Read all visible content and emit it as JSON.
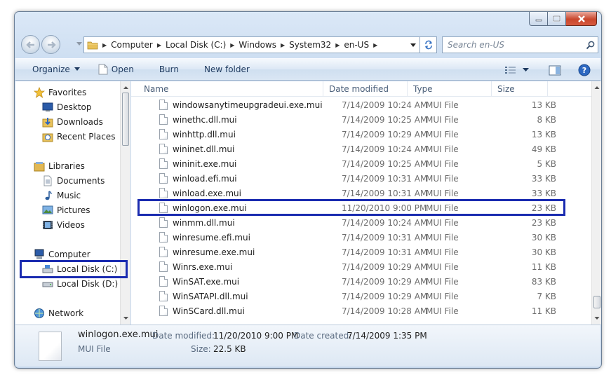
{
  "address": {
    "crumbs": [
      "Computer",
      "Local Disk (C:)",
      "Windows",
      "System32",
      "en-US"
    ]
  },
  "search": {
    "placeholder": "Search en-US"
  },
  "toolbar": {
    "organize": "Organize",
    "open": "Open",
    "burn": "Burn",
    "new_folder": "New folder"
  },
  "nav": {
    "favorites": "Favorites",
    "desktop": "Desktop",
    "downloads": "Downloads",
    "recent_places": "Recent Places",
    "libraries": "Libraries",
    "documents": "Documents",
    "music": "Music",
    "pictures": "Pictures",
    "videos": "Videos",
    "computer": "Computer",
    "local_disk_c": "Local Disk (C:)",
    "local_disk_d": "Local Disk (D:)",
    "network": "Network"
  },
  "columns": {
    "name": "Name",
    "date_modified": "Date modified",
    "type": "Type",
    "size": "Size"
  },
  "files": [
    {
      "name": "windowsanytimeupgradeui.exe.mui",
      "date": "7/14/2009 10:24 AM",
      "type": "MUI File",
      "size": "13 KB"
    },
    {
      "name": "winethc.dll.mui",
      "date": "7/14/2009 10:25 AM",
      "type": "MUI File",
      "size": "8 KB"
    },
    {
      "name": "winhttp.dll.mui",
      "date": "7/14/2009 10:29 AM",
      "type": "MUI File",
      "size": "13 KB"
    },
    {
      "name": "wininet.dll.mui",
      "date": "7/14/2009 10:24 AM",
      "type": "MUI File",
      "size": "49 KB"
    },
    {
      "name": "wininit.exe.mui",
      "date": "7/14/2009 10:25 AM",
      "type": "MUI File",
      "size": "5 KB"
    },
    {
      "name": "winload.efi.mui",
      "date": "7/14/2009 10:31 AM",
      "type": "MUI File",
      "size": "33 KB"
    },
    {
      "name": "winload.exe.mui",
      "date": "7/14/2009 10:31 AM",
      "type": "MUI File",
      "size": "33 KB"
    },
    {
      "name": "winlogon.exe.mui",
      "date": "11/20/2010 9:00 PM",
      "type": "MUI File",
      "size": "23 KB"
    },
    {
      "name": "winmm.dll.mui",
      "date": "7/14/2009 10:24 AM",
      "type": "MUI File",
      "size": "23 KB"
    },
    {
      "name": "winresume.efi.mui",
      "date": "7/14/2009 10:31 AM",
      "type": "MUI File",
      "size": "30 KB"
    },
    {
      "name": "winresume.exe.mui",
      "date": "7/14/2009 10:31 AM",
      "type": "MUI File",
      "size": "30 KB"
    },
    {
      "name": "Winrs.exe.mui",
      "date": "7/14/2009 10:29 AM",
      "type": "MUI File",
      "size": "11 KB"
    },
    {
      "name": "WinSAT.exe.mui",
      "date": "7/14/2009 10:29 AM",
      "type": "MUI File",
      "size": "83 KB"
    },
    {
      "name": "WinSATAPI.dll.mui",
      "date": "7/14/2009 10:29 AM",
      "type": "MUI File",
      "size": "7 KB"
    },
    {
      "name": "WinSCard.dll.mui",
      "date": "7/14/2009 10:28 AM",
      "type": "MUI File",
      "size": "11 KB"
    }
  ],
  "details": {
    "file_name": "winlogon.exe.mui",
    "file_type": "MUI File",
    "date_modified_label": "Date modified:",
    "date_modified": "11/20/2010 9:00 PM",
    "date_created_label": "Date created:",
    "date_created": "7/14/2009 1:35 PM",
    "size_label": "Size:",
    "size": "22.5 KB"
  },
  "colors": {
    "highlight": "#1a2bb0",
    "window_frame": "#c4d6ec"
  }
}
